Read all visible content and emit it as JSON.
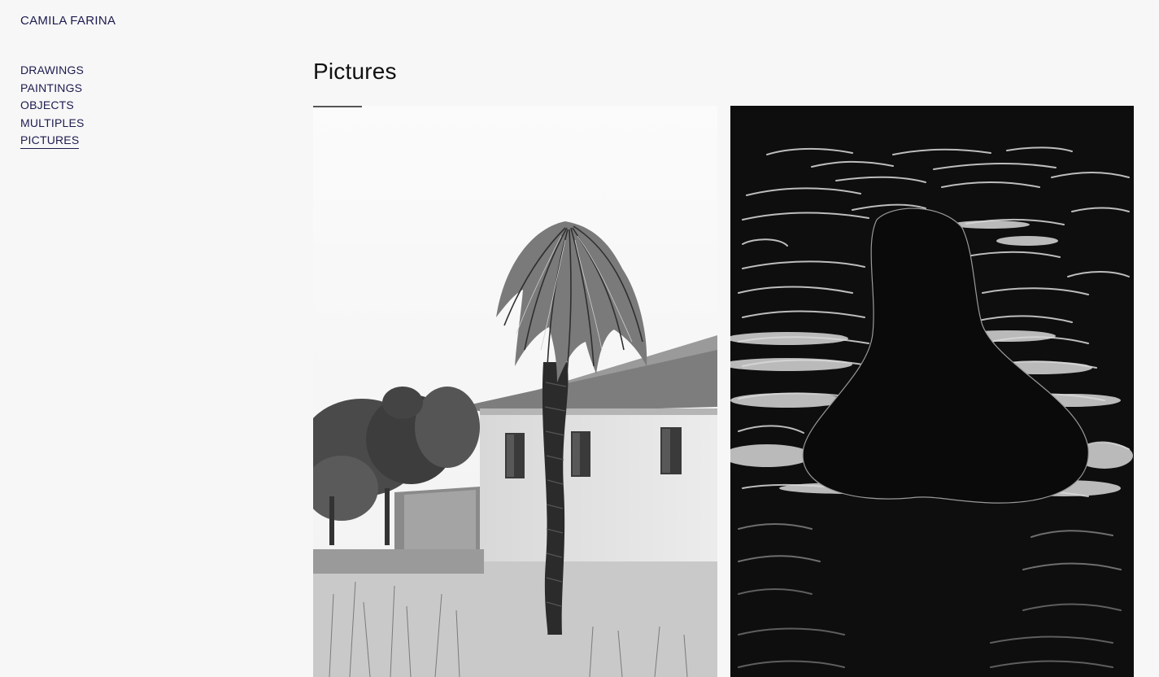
{
  "site": {
    "title": "CAMILA FARINA"
  },
  "nav": {
    "items": [
      {
        "label": "DRAWINGS",
        "active": false
      },
      {
        "label": "PAINTINGS",
        "active": false
      },
      {
        "label": "OBJECTS",
        "active": false
      },
      {
        "label": "MULTIPLES",
        "active": false
      },
      {
        "label": "PICTURES",
        "active": true
      }
    ]
  },
  "main": {
    "title": "Pictures",
    "images": [
      {
        "name": "palm-tree-photo"
      },
      {
        "name": "chalk-drawing-on-black"
      }
    ]
  }
}
